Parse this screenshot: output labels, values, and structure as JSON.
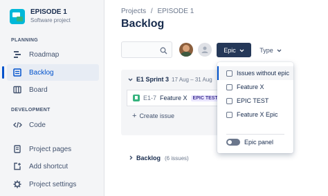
{
  "project": {
    "name": "EPISODE 1",
    "type": "Software project"
  },
  "sidebar": {
    "planning_label": "PLANNING",
    "development_label": "DEVELOPMENT",
    "items": [
      {
        "label": "Roadmap",
        "icon": "roadmap-icon"
      },
      {
        "label": "Backlog",
        "icon": "backlog-icon",
        "active": true
      },
      {
        "label": "Board",
        "icon": "board-icon"
      },
      {
        "label": "Code",
        "icon": "code-icon"
      },
      {
        "label": "Project pages",
        "icon": "page-icon"
      },
      {
        "label": "Add shortcut",
        "icon": "add-shortcut-icon"
      },
      {
        "label": "Project settings",
        "icon": "gear-icon"
      }
    ]
  },
  "breadcrumb": {
    "projects": "Projects",
    "separator": "/",
    "current": "EPISODE 1"
  },
  "page_title": "Backlog",
  "search": {
    "placeholder": ""
  },
  "filters": {
    "epic_label": "Epic",
    "type_label": "Type"
  },
  "sprint": {
    "name": "E1 Sprint 3",
    "dates": "17 Aug – 31 Aug",
    "issues": [
      {
        "key": "E1-7",
        "summary": "Feature X",
        "epic": "EPIC TEST"
      }
    ],
    "create_label": "Create issue"
  },
  "backlog": {
    "name": "Backlog",
    "count": "(6 issues)"
  },
  "epic_dropdown": {
    "options": [
      "Issues without epic",
      "Feature X",
      "EPIC TEST",
      "Feature X Epic"
    ],
    "toggle_label": "Epic panel",
    "toggle_on": false
  },
  "colors": {
    "accent": "#0052cc",
    "sidebar_bg": "#f4f5f7",
    "epic_button_bg": "#253858",
    "epic_lozenge_bg": "#eae6ff",
    "story_green": "#36b37e"
  }
}
